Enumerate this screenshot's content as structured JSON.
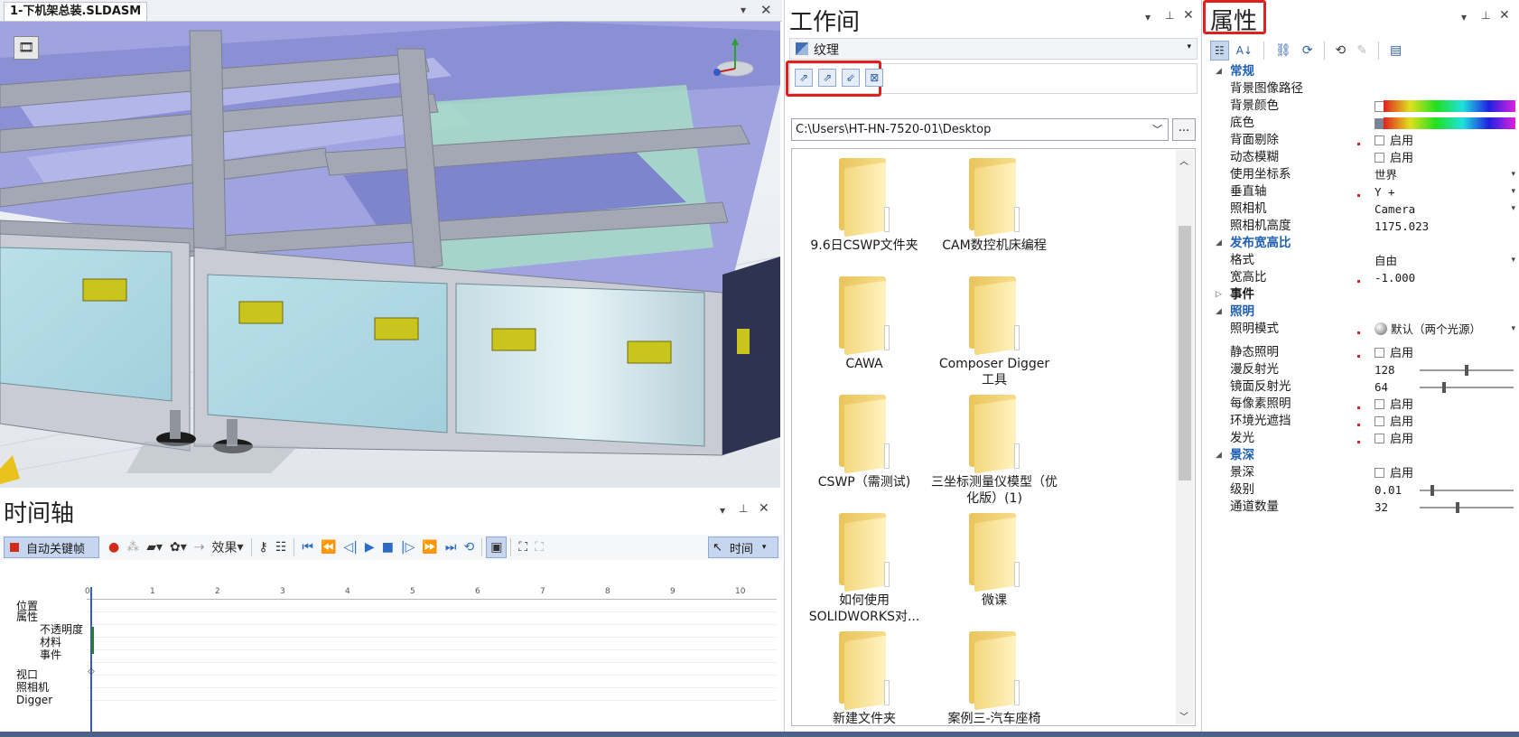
{
  "document": {
    "tab_title": "1-下机架总装.SLDASM"
  },
  "timeline": {
    "title": "时间轴",
    "auto_key_label": "自动关键帧",
    "effects_label": "效果",
    "time_label": "时间",
    "ruler_ticks": [
      "0",
      "1",
      "2",
      "3",
      "4",
      "5",
      "6",
      "7",
      "8",
      "9",
      "10"
    ],
    "tracks": [
      "位置",
      "属性",
      "不透明度",
      "材料",
      "事件",
      "视口",
      "照相机",
      "Digger"
    ]
  },
  "workspace": {
    "title": "工作间",
    "combo_label": "纹理",
    "path": "C:\\Users\\HT-HN-7520-01\\Desktop",
    "path_more": "...",
    "folders": [
      "9.6日CSWP文件夹",
      "CAM数控机床编程",
      "CAWA",
      "Composer Digger 工具",
      "CSWP（需测试)",
      "三坐标测量仪模型（优化版）(1)",
      "如何使用SOLIDWORKS对...",
      "微课",
      "新建文件夹",
      "案例三-汽车座椅"
    ]
  },
  "properties": {
    "title": "属性",
    "enable_label": "启用",
    "rows": [
      {
        "type": "cat",
        "name": "常规"
      },
      {
        "type": "text",
        "name": "背景图像路径",
        "value": ""
      },
      {
        "type": "color",
        "name": "背景颜色",
        "value": ""
      },
      {
        "type": "color",
        "name": "底色",
        "value": ""
      },
      {
        "type": "check",
        "name": "背面剔除",
        "value": "启用"
      },
      {
        "type": "check",
        "name": "动态模糊",
        "value": "启用"
      },
      {
        "type": "dd",
        "name": "使用坐标系",
        "value": "世界"
      },
      {
        "type": "dd",
        "name": "垂直轴",
        "value": "Y +"
      },
      {
        "type": "dd",
        "name": "照相机",
        "value": "Camera"
      },
      {
        "type": "text",
        "name": "照相机高度",
        "value": "1175.023"
      },
      {
        "type": "cat",
        "name": "发布宽高比"
      },
      {
        "type": "dd",
        "name": "格式",
        "value": "自由"
      },
      {
        "type": "text",
        "name": "宽高比",
        "value": "-1.000"
      },
      {
        "type": "collapsed",
        "name": "事件"
      },
      {
        "type": "cat",
        "name": "照明"
      },
      {
        "type": "dd",
        "name": "照明模式",
        "value": "默认（两个光源）"
      },
      {
        "type": "check",
        "name": "静态照明",
        "value": "启用"
      },
      {
        "type": "slider",
        "name": "漫反射光",
        "value": "128",
        "level": 0.5
      },
      {
        "type": "slider",
        "name": "镜面反射光",
        "value": "64",
        "level": 0.25
      },
      {
        "type": "check",
        "name": "每像素照明",
        "value": "启用"
      },
      {
        "type": "check",
        "name": "环境光遮挡",
        "value": "启用"
      },
      {
        "type": "check",
        "name": "发光",
        "value": "启用"
      },
      {
        "type": "cat",
        "name": "景深"
      },
      {
        "type": "check",
        "name": "景深",
        "value": "启用"
      },
      {
        "type": "slider",
        "name": "级别",
        "value": "0.01",
        "level": 0.12
      },
      {
        "type": "slider",
        "name": "通道数量",
        "value": "32",
        "level": 0.4
      }
    ]
  },
  "colors": {
    "accent": "#1e5fb4",
    "highlight": "#e0201c",
    "auto_key_bg": "#c6d6ef"
  }
}
